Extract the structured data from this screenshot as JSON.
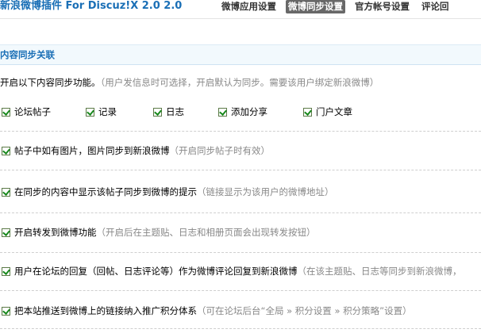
{
  "app_title": "新浪微博插件 For Discuz!X 2.0 2.0",
  "tabs": [
    {
      "label": "微博应用设置"
    },
    {
      "label": "微博同步设置"
    },
    {
      "label": "官方帐号设置"
    },
    {
      "label": "评论回"
    }
  ],
  "active_tab": 1,
  "section": {
    "title": "内容同步关联"
  },
  "intro": {
    "text": "开启以下内容同步功能。",
    "hint": "（用户发信息时可选择，开启默认为同步。需要该用户绑定新浪微博）"
  },
  "sync_items": [
    {
      "label": "论坛帖子",
      "checked": true
    },
    {
      "label": "记录",
      "checked": true
    },
    {
      "label": "日志",
      "checked": true
    },
    {
      "label": "添加分享",
      "checked": true
    },
    {
      "label": "门户文章",
      "checked": true
    }
  ],
  "options": [
    {
      "label": "帖子中如有图片，图片同步到新浪微博",
      "hint": "（开启同步帖子时有效）",
      "checked": true
    },
    {
      "label": "在同步的内容中显示该帖子同步到微博的提示",
      "hint": "（链接显示为该用户的微博地址）",
      "checked": true
    },
    {
      "label": "开启转发到微博功能",
      "hint": "（开启后在主题贴、日志和相册页面会出现转发按钮）",
      "checked": true
    },
    {
      "label": "用户在论坛的回复（回帖、日志评论等）作为微博评论回复到新浪微博",
      "hint": "（在该主题贴、日志等同步到新浪微博，",
      "checked": true
    },
    {
      "label": "把本站推送到微博上的链接纳入推广积分体系",
      "hint": "（可在论坛后台“全局 » 积分设置 » 积分策略”设置）",
      "checked": true
    }
  ],
  "colors": {
    "accent": "#1a6fb6",
    "check": "#17881b",
    "tab_active_bg": "#686868"
  }
}
